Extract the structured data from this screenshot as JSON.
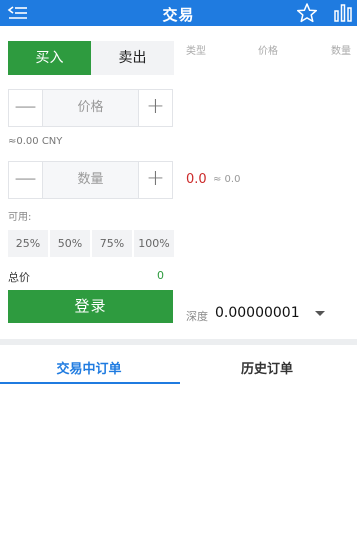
{
  "header": {
    "title": "交易"
  },
  "trade_tabs": {
    "buy": "买入",
    "sell": "卖出"
  },
  "orderbook_header": {
    "type": "类型",
    "price": "价格",
    "amount": "数量"
  },
  "price_input": {
    "placeholder": "价格",
    "minus": "—",
    "plus": "+"
  },
  "price_cny": "≈0.00 CNY",
  "amount_input": {
    "placeholder": "数量",
    "minus": "—",
    "plus": "+"
  },
  "last_price": "0.0",
  "last_price_approx": "≈ 0.0",
  "available_label": "可用:",
  "percent_buttons": [
    "25%",
    "50%",
    "75%",
    "100%"
  ],
  "total": {
    "label": "总价",
    "value": "0"
  },
  "login_button": "登录",
  "depth": {
    "label": "深度",
    "value": "0.00000001"
  },
  "order_tabs": {
    "active": "交易中订单",
    "history": "历史订单"
  },
  "colors": {
    "header_blue": "#1f7be0",
    "buy_green": "#2e9b3f",
    "price_red": "#cc2a2a"
  }
}
